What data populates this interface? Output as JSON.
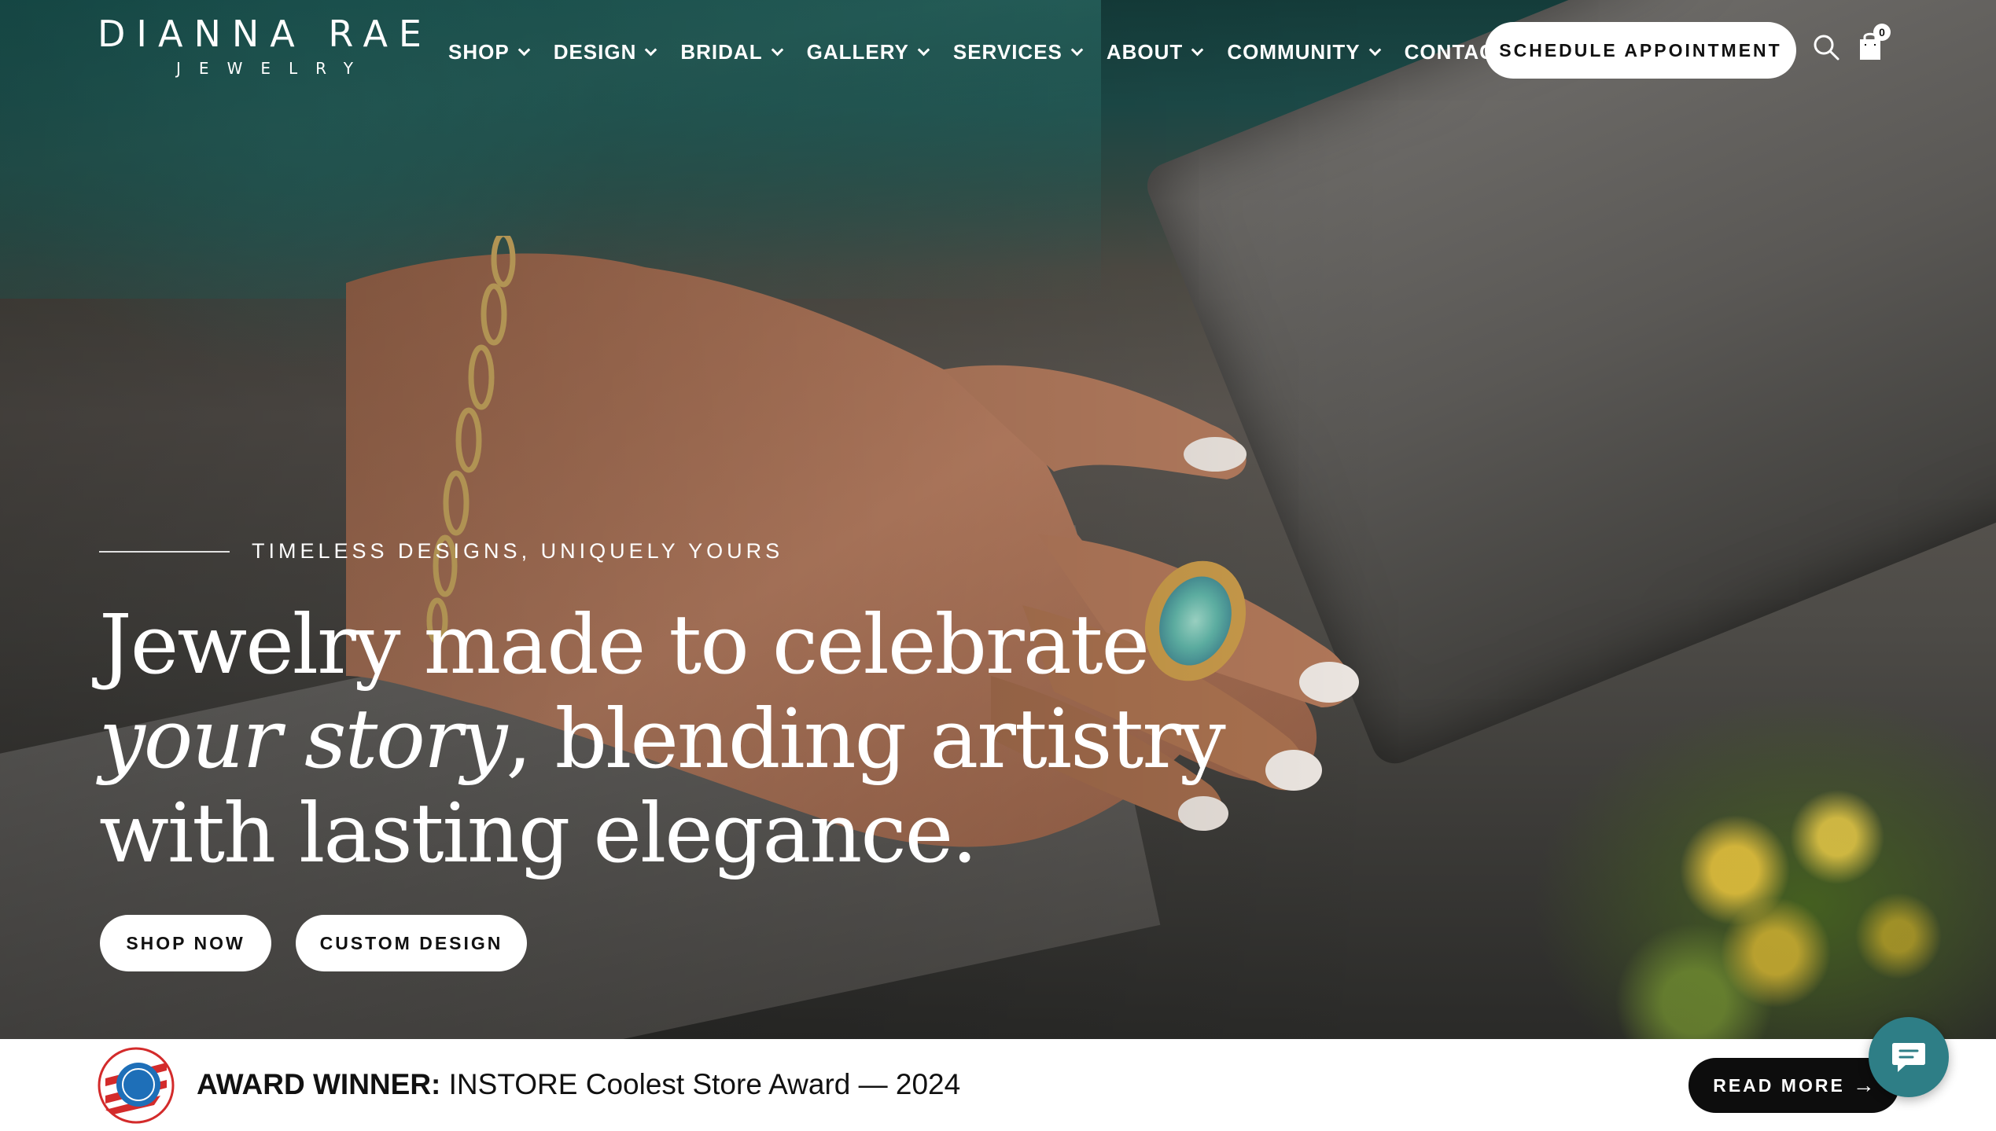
{
  "brand": {
    "logo_main": "DIANNA RAE",
    "logo_sub": "JEWELRY"
  },
  "nav": {
    "items": [
      {
        "label": "SHOP",
        "has_dropdown": true
      },
      {
        "label": "DESIGN",
        "has_dropdown": true
      },
      {
        "label": "BRIDAL",
        "has_dropdown": true
      },
      {
        "label": "GALLERY",
        "has_dropdown": true
      },
      {
        "label": "SERVICES",
        "has_dropdown": true
      },
      {
        "label": "ABOUT",
        "has_dropdown": true
      },
      {
        "label": "COMMUNITY",
        "has_dropdown": true
      },
      {
        "label": "CONTACT",
        "has_dropdown": false
      }
    ],
    "schedule_label": "SCHEDULE APPOINTMENT",
    "search_icon": "search-icon",
    "cart_icon": "shopping-bag-icon",
    "cart_count": "0"
  },
  "hero": {
    "eyebrow": "TIMELESS DESIGNS, UNIQUELY YOURS",
    "headline_line1": "Jewelry made to celebrate",
    "headline_line2_italic": "your story",
    "headline_line2_rest": ", blending artistry",
    "headline_line3": "with lasting elegance.",
    "shop_now_label": "SHOP NOW",
    "custom_design_label": "CUSTOM DESIGN"
  },
  "award": {
    "prefix": "AWARD WINNER:",
    "text": " INSTORE Coolest Store Award — 2024",
    "badge_icon": "award-badge-icon",
    "read_more_label": "READ MORE",
    "read_more_arrow": "→"
  },
  "chat": {
    "icon": "chat-bubble-icon"
  },
  "colors": {
    "accent_chat": "#2e7e86",
    "button_bg": "#ffffff",
    "button_dark": "#0d0d0d",
    "hero_teal": "#1f6a66"
  }
}
